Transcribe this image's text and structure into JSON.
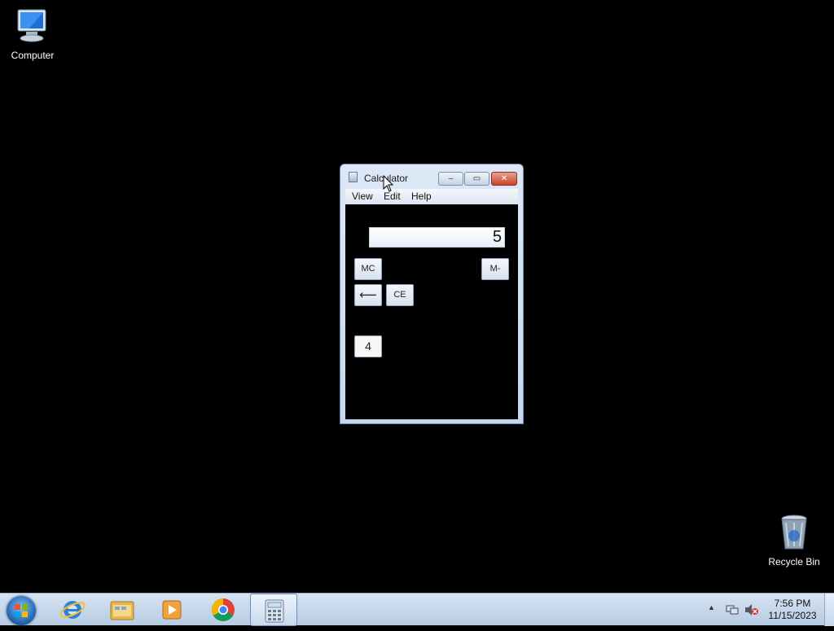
{
  "desktop": {
    "icons": [
      {
        "label": "Computer",
        "icon": "computer-icon"
      },
      {
        "label": "Recycle Bin",
        "icon": "recycle-bin-icon"
      }
    ]
  },
  "calculator": {
    "title": "Calculator",
    "menu": [
      "View",
      "Edit",
      "Help"
    ],
    "display": "5",
    "keys": {
      "mc": "MC",
      "mminus": "M-",
      "backspace": "⟵",
      "ce": "CE",
      "four": "4"
    },
    "controls": {
      "minimize": "‒",
      "maximize": "▭",
      "close": "✕"
    }
  },
  "taskbar": {
    "apps": [
      "internet-explorer-icon",
      "windows-explorer-icon",
      "media-player-icon",
      "chrome-icon",
      "calculator-icon"
    ],
    "active_app": "calculator-icon",
    "clock_time": "7:56 PM",
    "clock_date": "11/15/2023"
  },
  "colors": {
    "desktop_background": "#000000",
    "close_button": "#c7422b",
    "taskbar": "#c6d8ec"
  }
}
